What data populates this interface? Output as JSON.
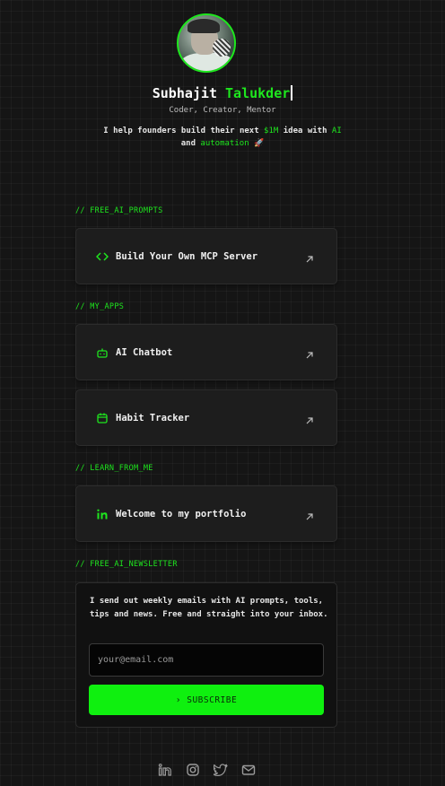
{
  "profile": {
    "first_name": "Subhajit",
    "last_name": "Talukder",
    "tagline": "Coder, Creator, Mentor",
    "bio_1": "I help founders build their next ",
    "bio_money": "$1M",
    "bio_2": " idea with ",
    "bio_ai": "AI",
    "bio_3": " and ",
    "bio_automation": "automation",
    "bio_rocket": "🚀"
  },
  "sections": {
    "prompts": "// FREE_AI_PROMPTS",
    "apps": "// MY_APPS",
    "learn": "// LEARN_FROM_ME",
    "newsletter": "// FREE_AI_NEWSLETTER"
  },
  "links": {
    "mcp": "Build Your Own MCP Server",
    "chatbot": "AI Chatbot",
    "habit": "Habit Tracker",
    "portfolio": "Welcome to my portfolio"
  },
  "newsletter": {
    "description": "I send out weekly emails with AI prompts, tools, tips and news. Free and straight into your inbox.",
    "placeholder": "your@email.com",
    "button": "› SUBSCRIBE"
  },
  "social": [
    "linkedin-icon",
    "instagram-icon",
    "twitter-icon",
    "mail-icon"
  ],
  "colors": {
    "accent": "#1ee61e",
    "button": "#0ff00f",
    "background": "#151515",
    "card": "#1d1d1d"
  }
}
